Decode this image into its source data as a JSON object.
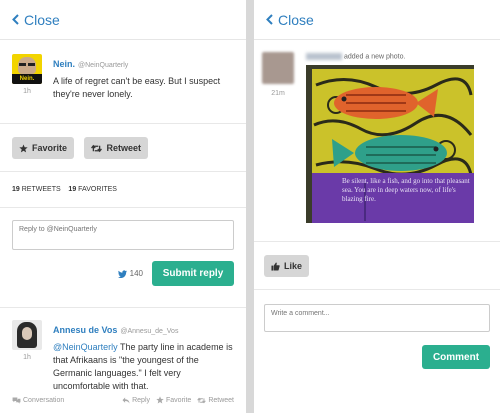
{
  "left": {
    "close_label": "Close",
    "tweet": {
      "name": "Nein.",
      "handle": "@NeinQuarterly",
      "time": "1h",
      "text": "A life of regret can't be easy. But I suspect they're never lonely.",
      "avatar_text": "Nein."
    },
    "favorite_label": "Favorite",
    "retweet_label": "Retweet",
    "stats": {
      "retweets_count": "19",
      "retweets_label": "RETWEETS",
      "favorites_count": "19",
      "favorites_label": "FAVORITES"
    },
    "reply_placeholder": "Reply to @NeinQuarterly",
    "char_count": "140",
    "submit_label": "Submit reply",
    "reply_tweet": {
      "name": "Annesu de Vos",
      "handle": "@Annesu_de_Vos",
      "time": "1h",
      "mention": "@NeinQuarterly",
      "text": " The party line in academe is that Afrikaans is \"the youngest of the Germanic languages.\" I felt very uncomfortable with that."
    },
    "actions": {
      "conversation": "Conversation",
      "reply": "Reply",
      "favorite": "Favorite",
      "retweet": "Retweet"
    }
  },
  "right": {
    "close_label": "Close",
    "post": {
      "action_text": "added a new photo.",
      "time": "21m",
      "photo_text": "Be silent, like a fish, and go into that pleasant sea. You are in deep waters now, of life's blazing fire."
    },
    "like_label": "Like",
    "comment_placeholder": "Write a comment...",
    "comment_button": "Comment"
  },
  "colors": {
    "accent": "#2f7fbf",
    "green": "#2baf8f",
    "divider": "#d8d8d8"
  }
}
